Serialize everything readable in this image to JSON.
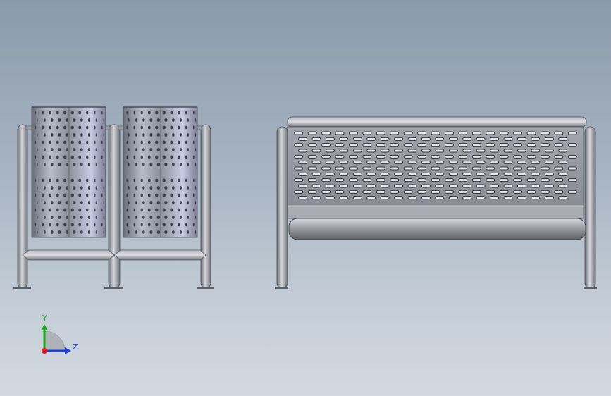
{
  "viewport": {
    "background_top": "#8b9aab",
    "background_bottom": "#d3d9e0"
  },
  "models": {
    "bins": {
      "count": 2,
      "hole_columns": 10,
      "hole_rows": 16
    },
    "bench": {
      "slot_columns": 21,
      "slot_rows": 12
    }
  },
  "triad": {
    "y_label": "Y",
    "z_label": "Z",
    "colors": {
      "y": "#1ea81e",
      "z": "#1e3fd8",
      "x": "#d81e1e"
    }
  }
}
